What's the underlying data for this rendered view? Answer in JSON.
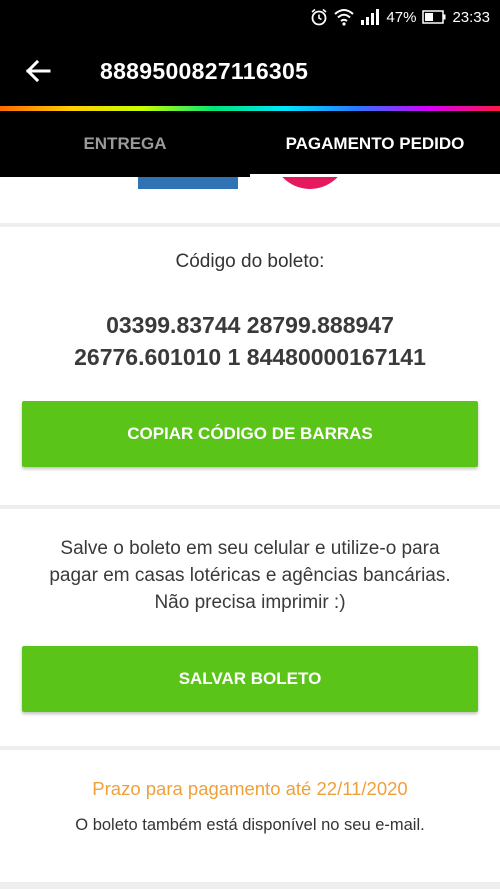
{
  "status_bar": {
    "battery": "47%",
    "time": "23:33",
    "icons": [
      "alarm-icon",
      "wifi-icon",
      "signal-icon",
      "battery-icon"
    ]
  },
  "app_bar": {
    "title": "8889500827116305",
    "back_icon": "arrow-left-icon"
  },
  "tabs": [
    {
      "label": "ENTREGA",
      "active": false
    },
    {
      "label": "PAGAMENTO PEDIDO",
      "active": true
    }
  ],
  "boleto": {
    "code_label": "Código do boleto:",
    "code_line1": "03399.83744 28799.888947",
    "code_line2": "26776.601010 1 84480000167141",
    "copy_button": "COPIAR CÓDIGO DE BARRAS"
  },
  "save": {
    "description": "Salve o boleto em seu celular e utilize-o para pagar em casas lotéricas e agências bancárias. Não precisa imprimir :)",
    "button": "SALVAR BOLETO"
  },
  "deadline": {
    "text": "Prazo para pagamento até 22/11/2020",
    "email_note": "O boleto também está disponível no seu e-mail."
  },
  "colors": {
    "accent_green": "#5bc418",
    "deadline_orange": "#f0a03a",
    "background": "#eeeeee"
  }
}
